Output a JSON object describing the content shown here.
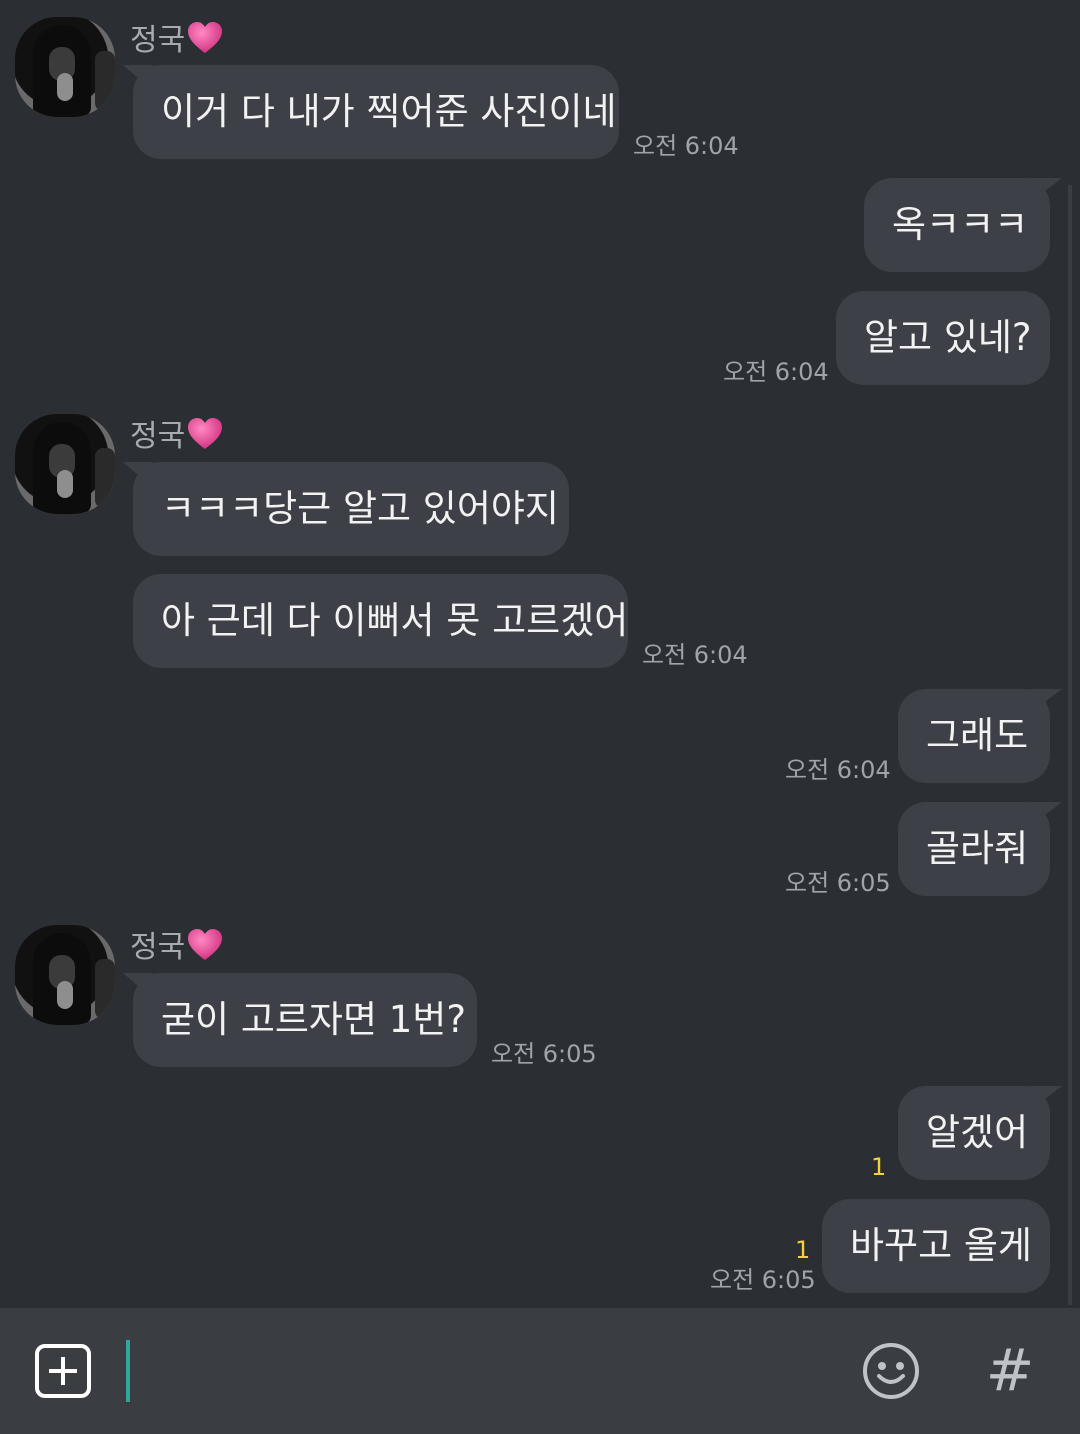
{
  "contact": {
    "name": "정국",
    "heart_icon": "pink-heart-icon"
  },
  "messages": [
    {
      "dir": "in",
      "text": "이거 다 내가 찍어준 사진이네",
      "time": "오전 6:04"
    },
    {
      "dir": "out",
      "text": "옥ㅋㅋㅋ",
      "time": ""
    },
    {
      "dir": "out",
      "text": "알고 있네?",
      "time": "오전 6:04"
    },
    {
      "dir": "in",
      "text": "ㅋㅋㅋ당근 알고 있어야지",
      "time": ""
    },
    {
      "dir": "in",
      "text": "아 근데 다 이뻐서 못 고르겠어",
      "time": "오전 6:04"
    },
    {
      "dir": "out",
      "text": "그래도",
      "time": "오전 6:04"
    },
    {
      "dir": "out",
      "text": "골라줘",
      "time": "오전 6:05"
    },
    {
      "dir": "in",
      "text": "굳이 고르자면 1번?",
      "time": "오전 6:05"
    },
    {
      "dir": "out",
      "text": "알겠어",
      "time": "",
      "unread": "1"
    },
    {
      "dir": "out",
      "text": "바꾸고 올게",
      "time": "오전 6:05",
      "unread": "1"
    }
  ],
  "composer": {
    "plus_icon": "plus-square-icon",
    "emoji_icon": "emoji-icon",
    "hash_label": "#"
  },
  "colors": {
    "background": "#2b2e33",
    "bubble": "#3d4047",
    "unread": "#f5d23a",
    "cursor": "#2fa89a"
  }
}
